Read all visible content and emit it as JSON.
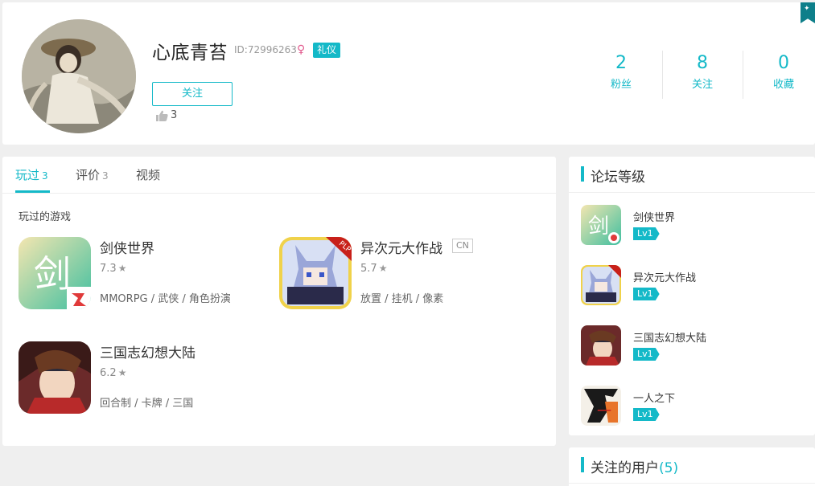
{
  "profile": {
    "nickname": "心底青苔",
    "id_text": "ID:72996263",
    "gender_icon": "♀",
    "badge": "礼仪",
    "follow_label": "关注",
    "like_count": "3",
    "stats": [
      {
        "num": "2",
        "label": "粉丝"
      },
      {
        "num": "8",
        "label": "关注"
      },
      {
        "num": "0",
        "label": "收藏"
      }
    ]
  },
  "tabs": [
    {
      "label": "玩过",
      "count": "3"
    },
    {
      "label": "评价",
      "count": "3"
    },
    {
      "label": "视频",
      "count": ""
    }
  ],
  "played_section_title": "玩过的游戏",
  "games": [
    {
      "name": "剑侠世界",
      "score": "7.3",
      "star": "★",
      "tags": "MMORPG / 武侠 / 角色扮演",
      "tag_cn": ""
    },
    {
      "name": "异次元大作战",
      "score": "5.7",
      "star": "★",
      "tags": "放置 / 挂机 / 像素",
      "tag_cn": "CN"
    },
    {
      "name": "三国志幻想大陆",
      "score": "6.2",
      "star": "★",
      "tags": "回合制 / 卡牌 / 三国",
      "tag_cn": ""
    }
  ],
  "forum": {
    "title": "论坛等级",
    "items": [
      {
        "name": "剑侠世界",
        "level": "Lv1"
      },
      {
        "name": "异次元大作战",
        "level": "Lv1"
      },
      {
        "name": "三国志幻想大陆",
        "level": "Lv1"
      },
      {
        "name": "一人之下",
        "level": "Lv1"
      }
    ]
  },
  "following": {
    "title": "关注的用户",
    "count": "(5)"
  },
  "colors": {
    "accent": "#14b9c8",
    "badge_pink": "#e25c8f",
    "background": "#efefef"
  }
}
